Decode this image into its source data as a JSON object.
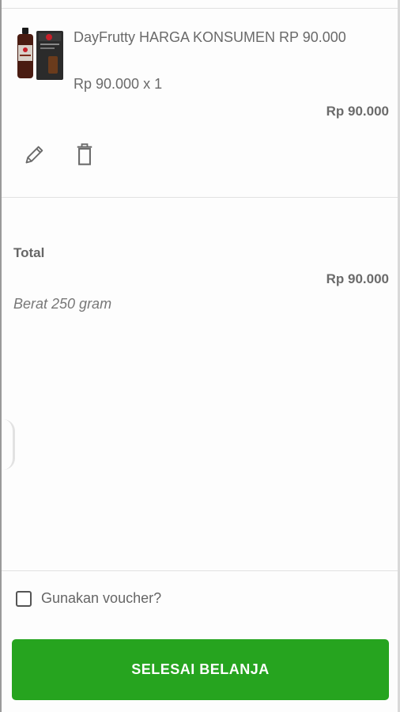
{
  "cart_item": {
    "name": "DayFrutty  HARGA KONSUMEN RP 90.000",
    "qty_line": "Rp 90.000 x 1",
    "subtotal": "Rp 90.000",
    "icons": {
      "edit": "pencil-icon",
      "delete": "trash-icon"
    }
  },
  "summary": {
    "total_label": "Total",
    "total_value": "Rp 90.000",
    "weight": "Berat 250 gram"
  },
  "voucher": {
    "label": "Gunakan voucher?",
    "checked": false
  },
  "checkout": {
    "label": "SELESAI BELANJA"
  },
  "colors": {
    "primary_button": "#26a41f"
  }
}
